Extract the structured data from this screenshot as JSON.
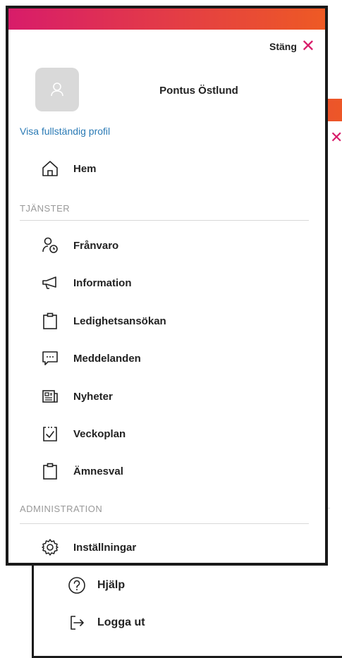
{
  "drawer": {
    "close_label": "Stäng",
    "user_name": "Pontus Östlund",
    "profile_link": "Visa fullständig profil",
    "home_label": "Hem",
    "sections": {
      "services_label": "TJÄNSTER",
      "admin_label": "ADMINISTRATION"
    },
    "services": [
      {
        "label": "Frånvaro",
        "icon": "absence-icon"
      },
      {
        "label": "Information",
        "icon": "megaphone-icon"
      },
      {
        "label": "Ledighetsansökan",
        "icon": "clipboard-icon"
      },
      {
        "label": "Meddelanden",
        "icon": "message-icon"
      },
      {
        "label": "Nyheter",
        "icon": "newspaper-icon"
      },
      {
        "label": "Veckoplan",
        "icon": "calendar-check-icon"
      },
      {
        "label": "Ämnesval",
        "icon": "clipboard-icon"
      }
    ],
    "admin": [
      {
        "label": "Inställningar",
        "icon": "gear-icon"
      }
    ]
  },
  "background_menu": {
    "items": [
      {
        "label": "Hjälp",
        "icon": "help-icon"
      },
      {
        "label": "Logga ut",
        "icon": "logout-icon"
      }
    ]
  },
  "colors": {
    "gradient_start": "#d81c6a",
    "gradient_end": "#ee5a24",
    "accent": "#d81c6a",
    "link": "#2a7ab5"
  }
}
